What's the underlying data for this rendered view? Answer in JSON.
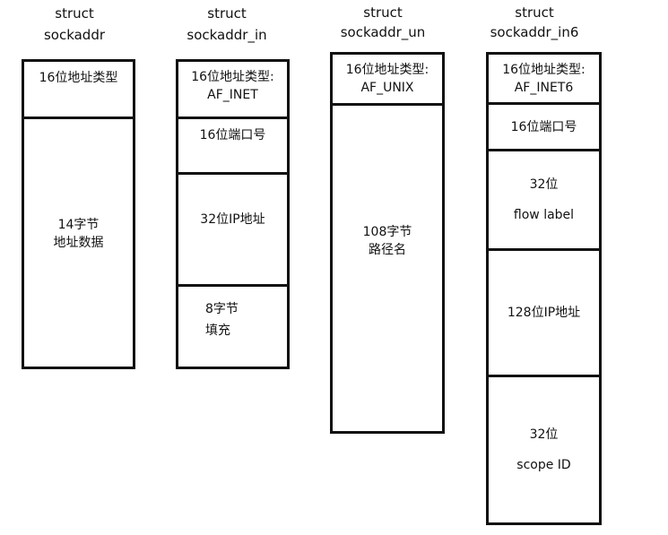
{
  "structs": [
    {
      "title_1": "struct",
      "title_2": "sockaddr",
      "fields": [
        {
          "lines": [
            "16位地址类型"
          ]
        },
        {
          "lines": [
            "14字节",
            "地址数据"
          ]
        }
      ]
    },
    {
      "title_1": "struct",
      "title_2": "sockaddr_in",
      "fields": [
        {
          "lines": [
            "16位地址类型:",
            "AF_INET"
          ]
        },
        {
          "lines": [
            "16位端口号"
          ]
        },
        {
          "lines": [
            "32位IP地址"
          ]
        },
        {
          "lines": [
            "8字节",
            "填充"
          ]
        }
      ]
    },
    {
      "title_1": "struct",
      "title_2": "sockaddr_un",
      "fields": [
        {
          "lines": [
            "16位地址类型:",
            "AF_UNIX"
          ]
        },
        {
          "lines": [
            "108字节",
            "路径名"
          ]
        }
      ]
    },
    {
      "title_1": "struct",
      "title_2": "sockaddr_in6",
      "fields": [
        {
          "lines": [
            "16位地址类型:",
            "AF_INET6"
          ]
        },
        {
          "lines": [
            "16位端口号"
          ]
        },
        {
          "lines": [
            "32位",
            "flow label"
          ]
        },
        {
          "lines": [
            "128位IP地址"
          ]
        },
        {
          "lines": [
            "32位",
            "scope ID"
          ]
        }
      ]
    }
  ]
}
